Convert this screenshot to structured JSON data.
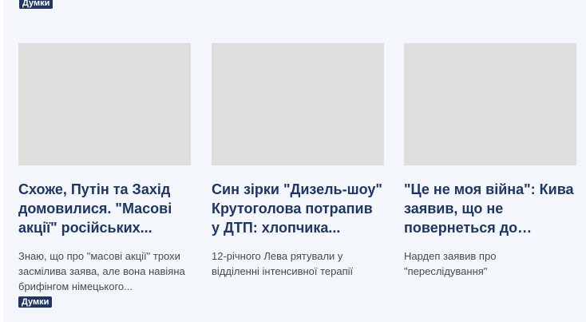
{
  "top_badge": {
    "label": "Думки"
  },
  "cards": [
    {
      "title": "Схоже, Путін та Захід домовилися. \"Масові акції\" російських...",
      "lead": "Знаю, що про \"масові акції\" трохи засмілива заява, але вона навіяна брифінгом німецького...",
      "badge": "Думки"
    },
    {
      "title": "Син зірки \"Дизель-шоу\" Крутоголова потрапив у ДТП: хлопчика...",
      "lead": "12-річного Лева рятували у відділенні інтенсивної терапії"
    },
    {
      "title": "\"Це не моя війна\": Кива заявив, що не повернеться до Україн...",
      "lead": "Нардеп заявив про \"переслідування\""
    }
  ],
  "colors": {
    "panel_background": "#f3f7fc",
    "headline": "#1f3566",
    "badge_background": "#1f3566",
    "thumbnail_placeholder": "#dedede"
  }
}
